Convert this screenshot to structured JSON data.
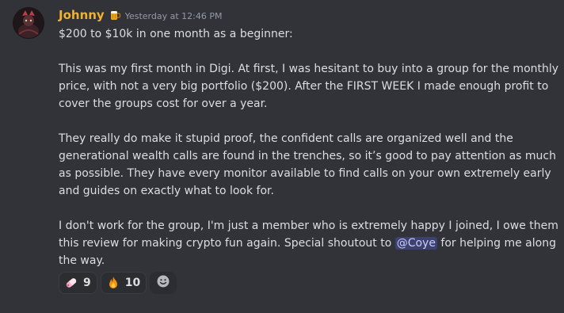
{
  "message": {
    "username": "Johnny",
    "timestamp": "Yesterday at 12:46 PM",
    "role_icon": "beer-mug-badge-icon",
    "avatar": "user-avatar",
    "lines": {
      "title": "$200 to $10k in one month as a beginner:",
      "p1": "This was my first month in Digi. At first, I was hesitant to buy into a group for the monthly price, with not a very big portfolio ($200).  After the FIRST WEEK I made enough profit to cover the groups cost for over a year.",
      "p2": "They really do make it stupid proof, the confident calls are organized well and the generational wealth calls are found in the trenches, so it’s good to pay attention as much as possible. They have every monitor available to find calls on your own extremely early and guides on exactly what to look for.",
      "p3_before": "I don't work for the group, I'm just a member who is extremely happy I joined, I owe them this review for making crypto fun again. Special shoutout to ",
      "p3_mention": "@Coye",
      "p3_after": " for helping me along the way."
    },
    "colors": {
      "background": "#313338",
      "username": "#f0b232",
      "text": "#dbdee1",
      "timestamp": "#949ba4",
      "mention_bg": "#414775"
    }
  },
  "reactions": [
    {
      "emoji": "pink-pill-icon",
      "count": "9"
    },
    {
      "emoji": "fire-icon",
      "count": "10"
    }
  ],
  "add_reaction": {
    "icon": "add-reaction-smiley-icon"
  }
}
